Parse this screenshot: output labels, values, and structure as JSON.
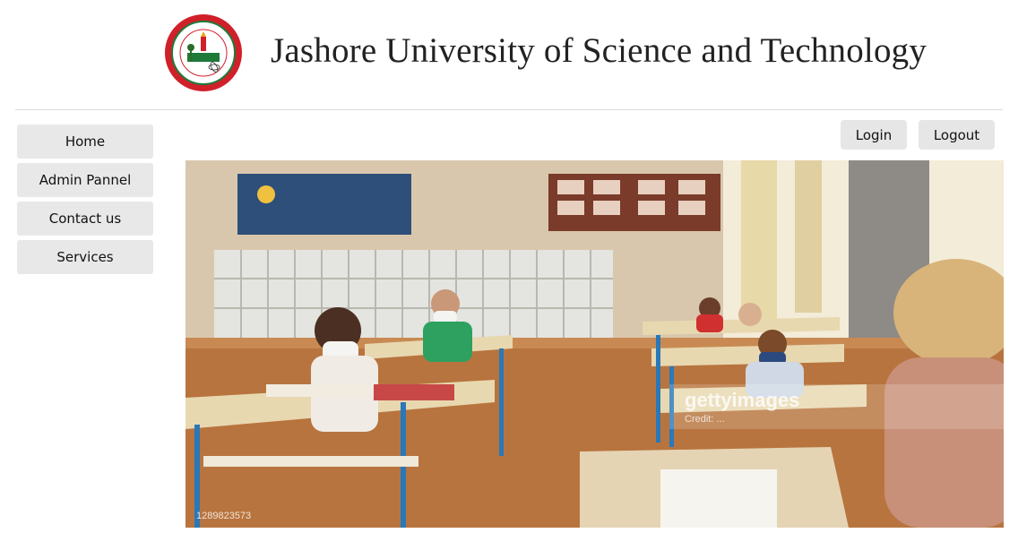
{
  "header": {
    "title": "Jashore University of Science and Technology",
    "logo_icon": "university-seal-logo"
  },
  "sidebar": {
    "items": [
      {
        "label": "Home"
      },
      {
        "label": "Admin Pannel"
      },
      {
        "label": "Contact us"
      },
      {
        "label": "Services"
      }
    ]
  },
  "auth": {
    "login_label": "Login",
    "logout_label": "Logout"
  },
  "hero": {
    "watermark": "gettyimages",
    "watermark_sub": "Credit: ...",
    "image_id": "1289823573"
  },
  "colors": {
    "nav_bg": "#e8e8e8",
    "seal_red": "#d0202a",
    "seal_green": "#1f7a3a"
  }
}
